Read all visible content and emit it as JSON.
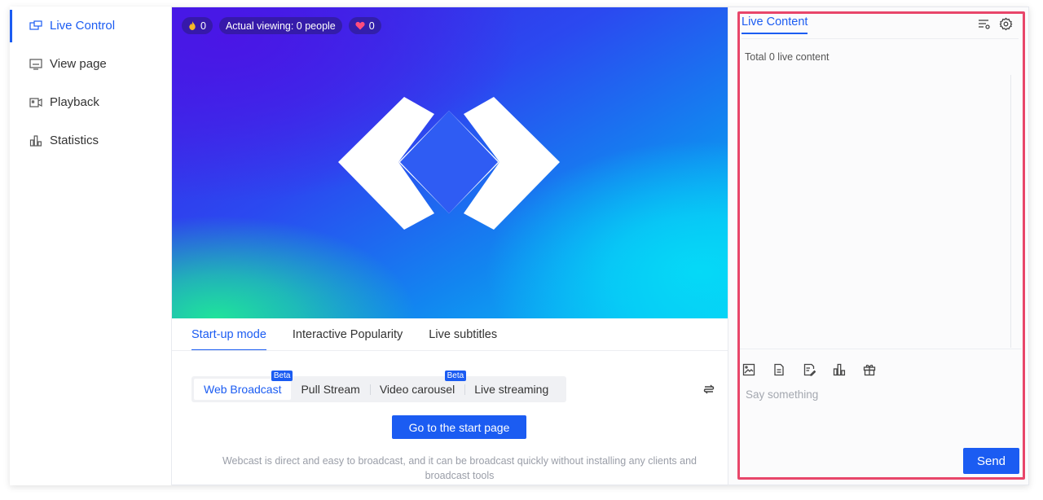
{
  "sidebar": {
    "items": [
      {
        "label": "Live Control",
        "icon": "live-control-icon",
        "active": true
      },
      {
        "label": "View page",
        "icon": "view-page-icon"
      },
      {
        "label": "Playback",
        "icon": "playback-icon"
      },
      {
        "label": "Statistics",
        "icon": "statistics-icon"
      }
    ]
  },
  "video": {
    "popularity": "0",
    "viewing": "Actual viewing: 0 people",
    "likes": "0"
  },
  "tabs": [
    "Start-up mode",
    "Interactive Popularity",
    "Live subtitles"
  ],
  "modes": [
    {
      "label": "Web Broadcast",
      "badge": "Beta",
      "active": true
    },
    {
      "label": "Pull Stream"
    },
    {
      "label": "Video carousel",
      "badge": "Beta"
    },
    {
      "label": "Live streaming"
    }
  ],
  "start_button": "Go to the start page",
  "description": "Webcast is direct and easy to broadcast, and it can be broadcast quickly without installing any clients and broadcast tools",
  "panel": {
    "title": "Live Content",
    "total": "Total 0 live content",
    "input_placeholder": "Say something",
    "send": "Send",
    "tools": [
      "image-icon",
      "document-icon",
      "edit-note-icon",
      "bar-chart-icon",
      "gift-icon"
    ]
  },
  "colors": {
    "accent": "#1b5cf2",
    "highlight": "#e8466a"
  }
}
